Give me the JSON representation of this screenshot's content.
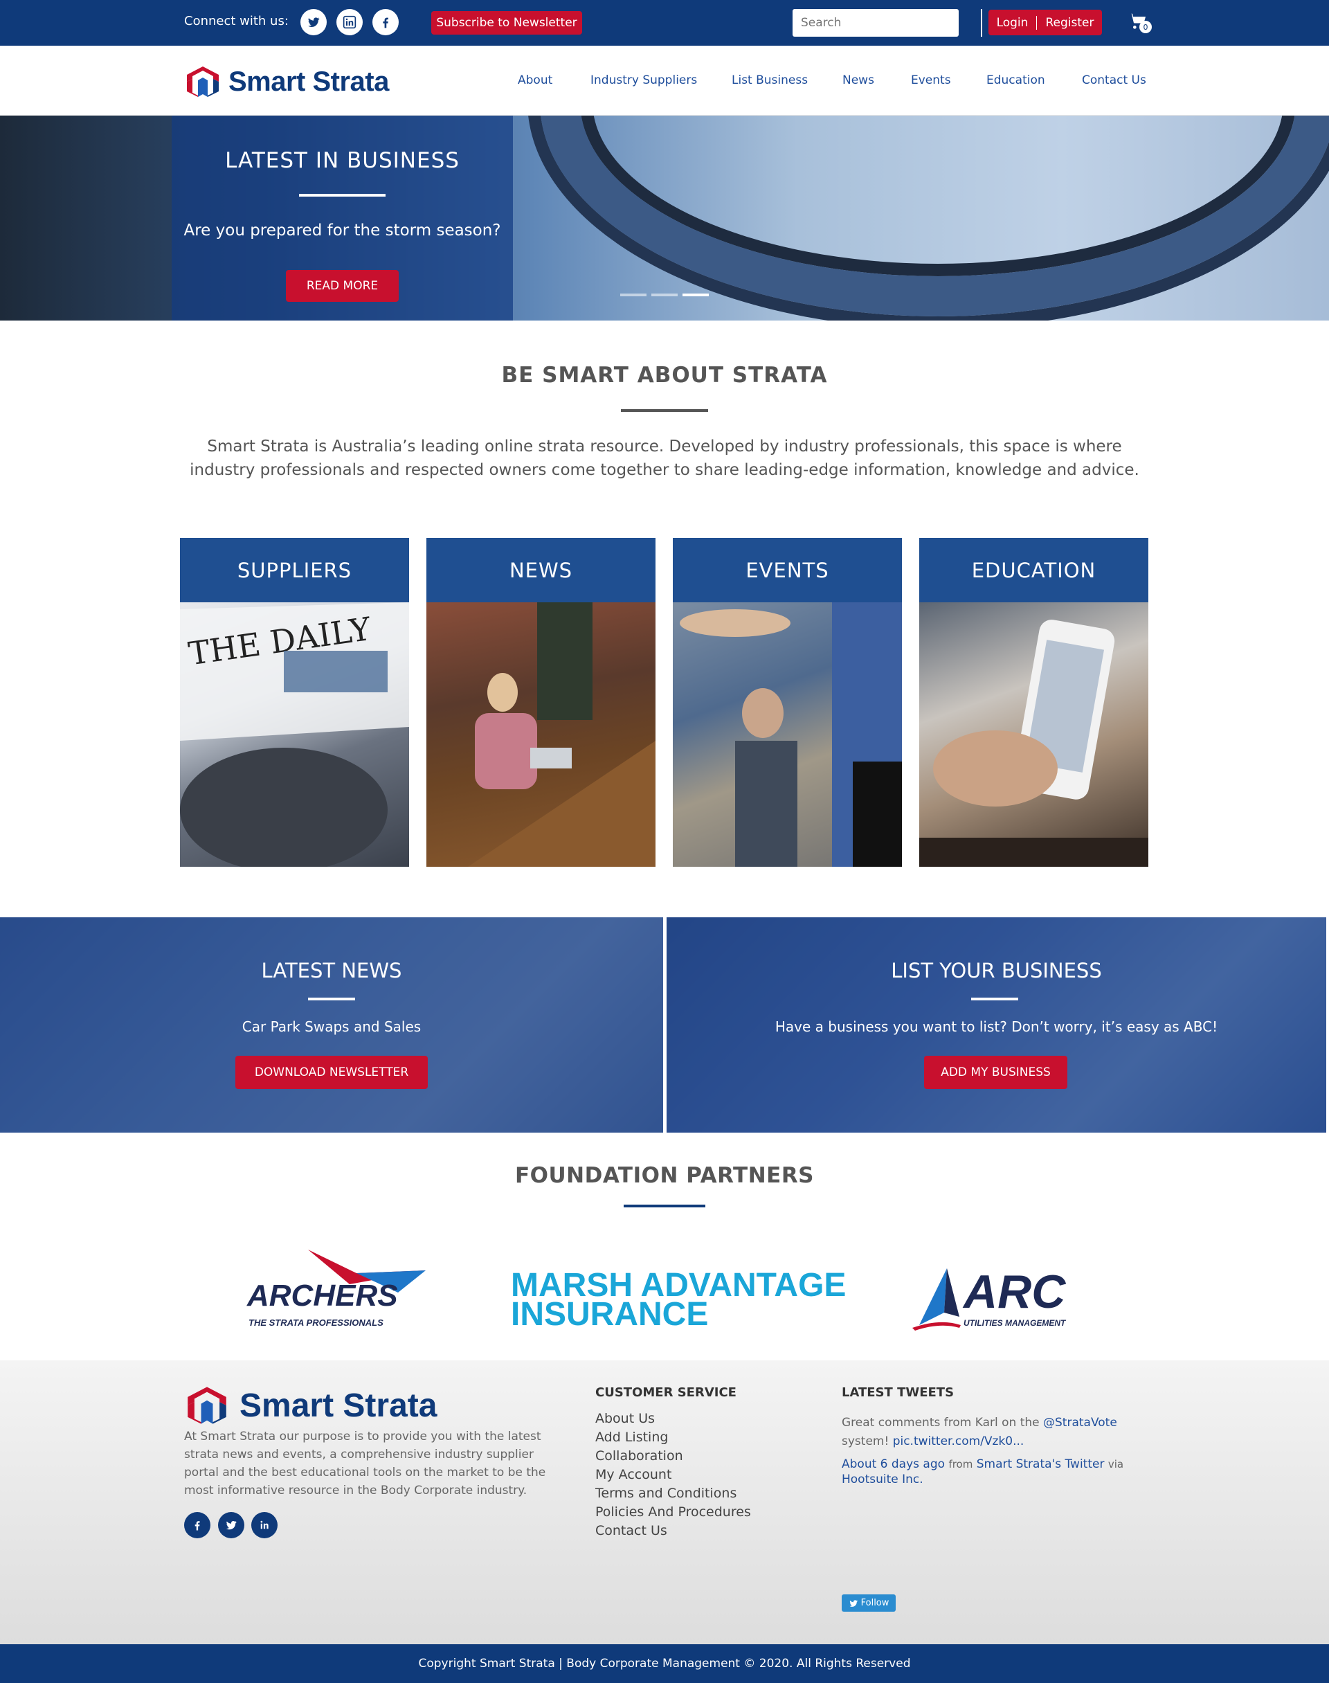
{
  "topbar": {
    "connect_label": "Connect with us:",
    "social": [
      {
        "icon": "twitter-icon"
      },
      {
        "icon": "linkedin-icon"
      },
      {
        "icon": "facebook-icon"
      }
    ],
    "subscribe_label": "Subscribe to Newsletter",
    "search_placeholder": "Search",
    "login_label": "Login",
    "register_label": "Register",
    "cart_count": "0"
  },
  "nav": {
    "logo_text": "Smart Strata",
    "items": [
      "About",
      "Industry Suppliers",
      "List Business",
      "News",
      "Events",
      "Education",
      "Contact Us"
    ]
  },
  "hero": {
    "title": "LATEST IN BUSINESS",
    "subtitle": "Are you prepared for the storm season?",
    "button_label": "READ MORE",
    "slides": 3,
    "active_slide": 3
  },
  "intro": {
    "title": "BE SMART ABOUT STRATA",
    "text": "Smart Strata is Australia’s leading online strata resource. Developed by industry professionals, this space is where industry professionals and respected owners come together to share leading-edge information, knowledge and advice."
  },
  "cards": [
    {
      "label": "SUPPLIERS"
    },
    {
      "label": "NEWS"
    },
    {
      "label": "EVENTS"
    },
    {
      "label": "EDUCATION"
    }
  ],
  "cta": {
    "news": {
      "title": "LATEST NEWS",
      "text": "Car Park Swaps and Sales",
      "button": "DOWNLOAD NEWSLETTER"
    },
    "business": {
      "title": "LIST YOUR BUSINESS",
      "text": "Have a business you want to list? Don’t worry, it’s easy as ABC!",
      "button": "ADD MY BUSINESS"
    }
  },
  "partners": {
    "title": "FOUNDATION PARTNERS",
    "archers": {
      "name": "ARCHERS",
      "tagline": "THE STRATA PROFESSIONALS"
    },
    "marsh": {
      "line1": "MARSH ADVANTAGE",
      "line2": "INSURANCE"
    },
    "arc": {
      "name": "ARC",
      "tagline": "UTILITIES MANAGEMENT"
    }
  },
  "footer": {
    "logo_text": "Smart Strata",
    "about": "At Smart Strata our purpose is to provide you with the latest strata news and events, a comprehensive industry supplier portal and the best educational tools on the market to be the most informative resource in the Body Corporate industry.",
    "customer_service_title": "CUSTOMER SERVICE",
    "links": [
      "About Us",
      "Add Listing",
      "Collaboration",
      "My Account",
      "Terms and Conditions",
      "Policies And Procedures",
      "Contact Us"
    ],
    "tweets_title": "LATEST TWEETS",
    "tweet": {
      "text_pre": "Great comments from Karl on the",
      "handle": "@StrataVote",
      "text_post": "system!",
      "pic_link": "pic.twitter.com/Vzk0...",
      "time": "About 6 days ago",
      "from_label": "from",
      "source": "Smart Strata's Twitter",
      "via_label": "via",
      "client": "Hootsuite Inc."
    },
    "follow_label": "Follow"
  },
  "copyright": "Copyright Smart Strata | Body Corporate Management © 2020. All Rights Reserved",
  "colors": {
    "brand_blue": "#0f3a7a",
    "accent_red": "#c8102e",
    "card_header": "#1f4f91"
  }
}
